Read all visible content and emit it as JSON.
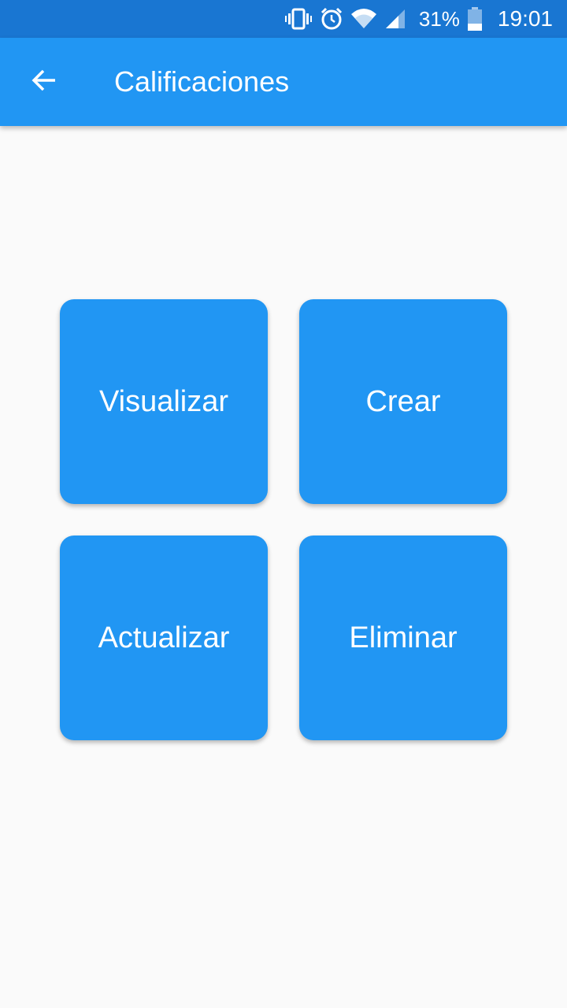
{
  "status_bar": {
    "icons": [
      "vibrate-icon",
      "alarm-icon",
      "wifi-icon",
      "signal-icon",
      "battery-icon"
    ],
    "battery": "31%",
    "time": "19:01",
    "background": "#1976d2"
  },
  "app_bar": {
    "title": "Calificaciones",
    "back_icon": "arrow-left-icon",
    "background": "#2196f3"
  },
  "actions": [
    {
      "label": "Visualizar"
    },
    {
      "label": "Crear"
    },
    {
      "label": "Actualizar"
    },
    {
      "label": "Eliminar"
    }
  ],
  "colors": {
    "tile": "#2196f3",
    "page_background": "#fafafa"
  }
}
